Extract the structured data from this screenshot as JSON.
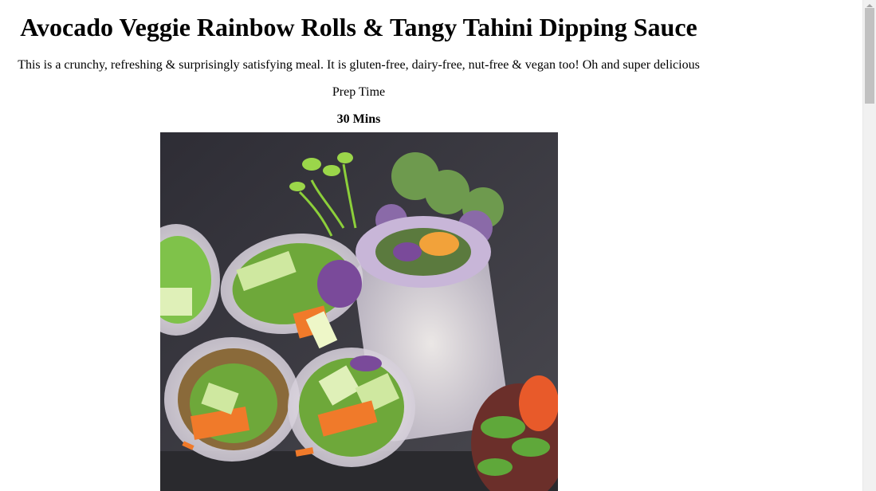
{
  "recipe": {
    "title": "Avocado Veggie Rainbow Rolls & Tangy Tahini Dipping Sauce",
    "description": "This is a crunchy, refreshing & surprisingly satisfying meal. It is gluten-free, dairy-free, nut-free & vegan too! Oh and super delicious",
    "prep_time_label": "Prep Time",
    "prep_time_value": "30 Mins",
    "photo_icon": "food-photo-icon"
  },
  "scrollbar": {
    "position": 0.0
  },
  "colors": {
    "photo_background": "#3a3a42",
    "wrap_green": "#7fc24a",
    "carrot_orange": "#f07a2a",
    "cabbage_purple": "#7a4a9a"
  }
}
